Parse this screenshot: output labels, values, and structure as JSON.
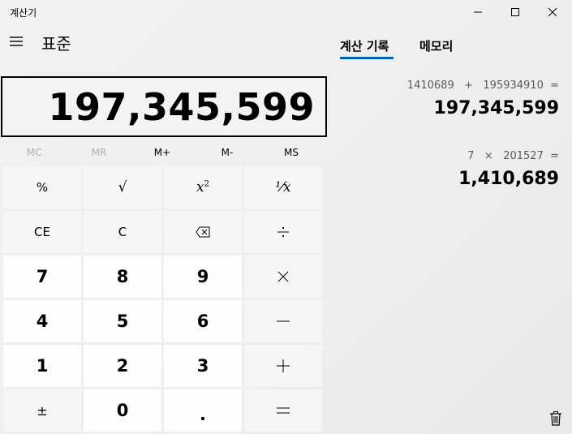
{
  "window": {
    "title": "계산기"
  },
  "header": {
    "mode_title": "표준"
  },
  "display": {
    "value": "197,345,599"
  },
  "memory": {
    "buttons": [
      {
        "label": "MC",
        "enabled": false
      },
      {
        "label": "MR",
        "enabled": false
      },
      {
        "label": "M+",
        "enabled": true
      },
      {
        "label": "M-",
        "enabled": true
      },
      {
        "label": "MS",
        "enabled": true
      }
    ]
  },
  "keypad": {
    "percent": "%",
    "sqrt": "√",
    "square_base": "x",
    "square_exp": "2",
    "reciprocal": "¹⁄x",
    "ce": "CE",
    "c": "C",
    "digits": {
      "d7": "7",
      "d8": "8",
      "d9": "9",
      "d4": "4",
      "d5": "5",
      "d6": "6",
      "d1": "1",
      "d2": "2",
      "d3": "3",
      "d0": "0"
    },
    "negate": "±",
    "decimal": "."
  },
  "history_pane": {
    "tabs": [
      {
        "label": "계산 기록",
        "active": true
      },
      {
        "label": "메모리",
        "active": false
      }
    ],
    "entries": [
      {
        "expression": "1410689   +   195934910  =",
        "result": "197,345,599"
      },
      {
        "expression": "7   ×   201527  =",
        "result": "1,410,689"
      }
    ]
  },
  "colors": {
    "accent": "#0063b1",
    "disabled_text": "#b0b0b0"
  },
  "icons": {
    "hamburger": "hamburger-icon",
    "backspace": "backspace-icon",
    "trash": "trash-icon",
    "minimize": "minimize-icon",
    "maximize": "maximize-icon",
    "close": "close-icon"
  }
}
